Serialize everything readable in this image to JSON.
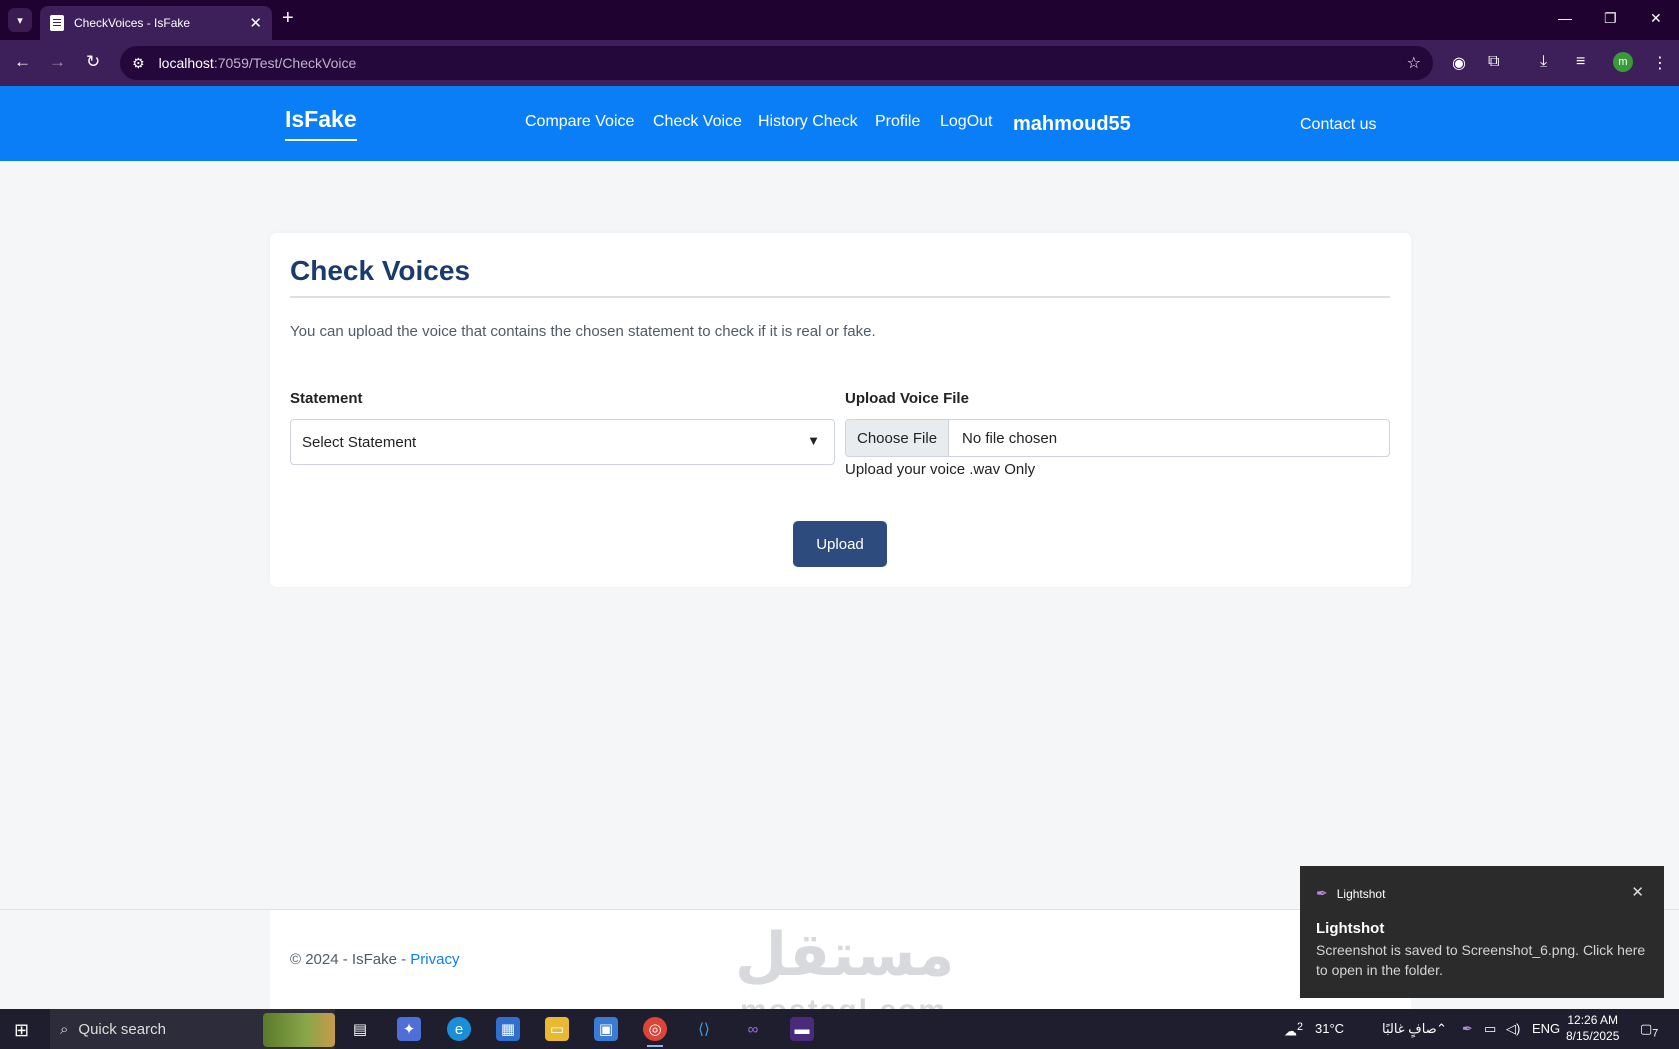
{
  "browser": {
    "tab_title": "CheckVoices - IsFake",
    "url_host": "localhost",
    "url_rest": ":7059/Test/CheckVoice"
  },
  "navbar": {
    "brand": "IsFake",
    "links": [
      "Compare Voice",
      "Check Voice",
      "History Check",
      "Profile",
      "LogOut"
    ],
    "username": "mahmoud55",
    "contact": "Contact us"
  },
  "card": {
    "title": "Check Voices",
    "description": "You can upload the voice that contains the chosen statement to check if it is real or fake.",
    "statement_label": "Statement",
    "statement_selected": "Select Statement",
    "upload_label": "Upload Voice File",
    "choose_file": "Choose File",
    "no_file": "No file chosen",
    "hint": "Upload your voice .wav Only",
    "upload_button": "Upload"
  },
  "footer": {
    "copyright": "© 2024 - IsFake - ",
    "privacy": "Privacy"
  },
  "watermark": {
    "arabic": "مستقل",
    "latin": "mostaql.com"
  },
  "toast": {
    "app": "Lightshot",
    "title": "Lightshot",
    "message": "Screenshot is saved to Screenshot_6.png. Click here to open in the folder."
  },
  "taskbar": {
    "search": "Quick search",
    "weather_badge": "2",
    "temperature": "31°C",
    "weather_text": "صافٍ غالبًا",
    "language": "ENG",
    "time": "12:26 AM",
    "date": "8/15/2025",
    "notif_count": "7"
  },
  "colors": {
    "navbar": "#0a7ef7",
    "primary_button": "#2d4b7c",
    "title": "#1b3b6e",
    "chrome": "#3d1f5a"
  }
}
